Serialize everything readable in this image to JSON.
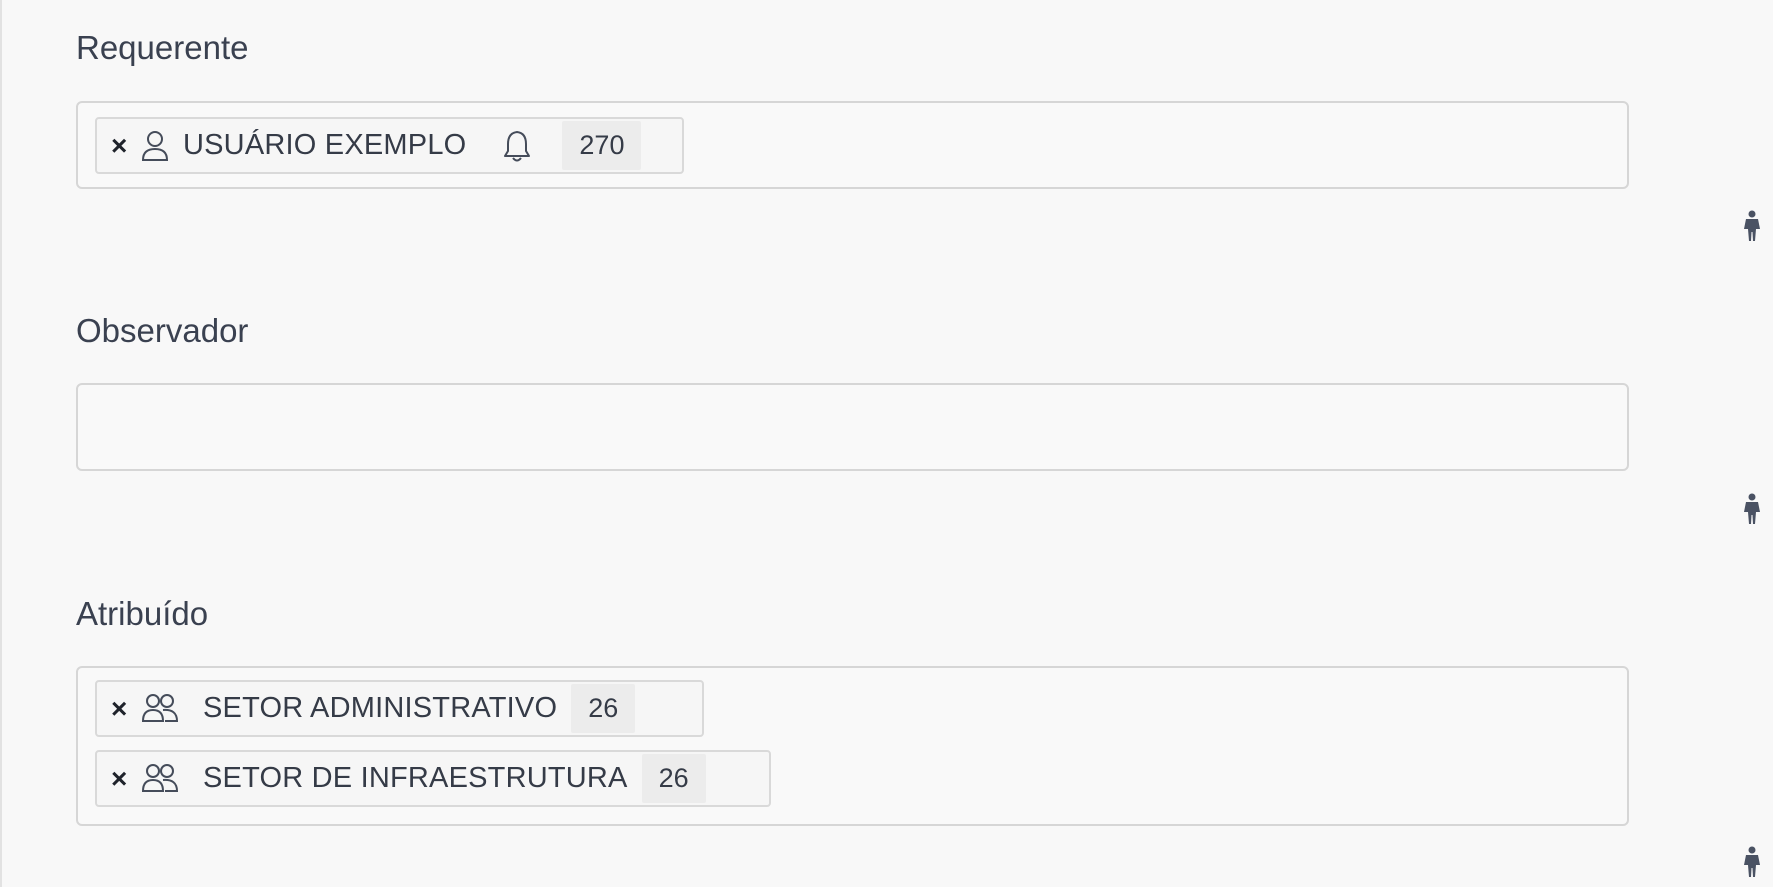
{
  "requester": {
    "label": "Requerente",
    "chips": [
      {
        "remove_symbol": "×",
        "name": "USUÁRIO EXEMPLO",
        "icon": "user-icon",
        "notify_icon": "bell-icon",
        "count": "270"
      }
    ]
  },
  "observer": {
    "label": "Observador",
    "chips": []
  },
  "assigned": {
    "label": "Atribuído",
    "chips": [
      {
        "remove_symbol": "×",
        "name": "SETOR ADMINISTRATIVO",
        "icon": "group-icon",
        "count": "26"
      },
      {
        "remove_symbol": "×",
        "name": "SETOR DE INFRAESTRUTURA",
        "icon": "group-icon",
        "count": "26"
      }
    ]
  },
  "colors": {
    "background": "#f8f8f8",
    "border": "#d6d6d6",
    "text": "#353b47",
    "count_bg": "#ececec",
    "actor_icon": "#4a5263"
  }
}
